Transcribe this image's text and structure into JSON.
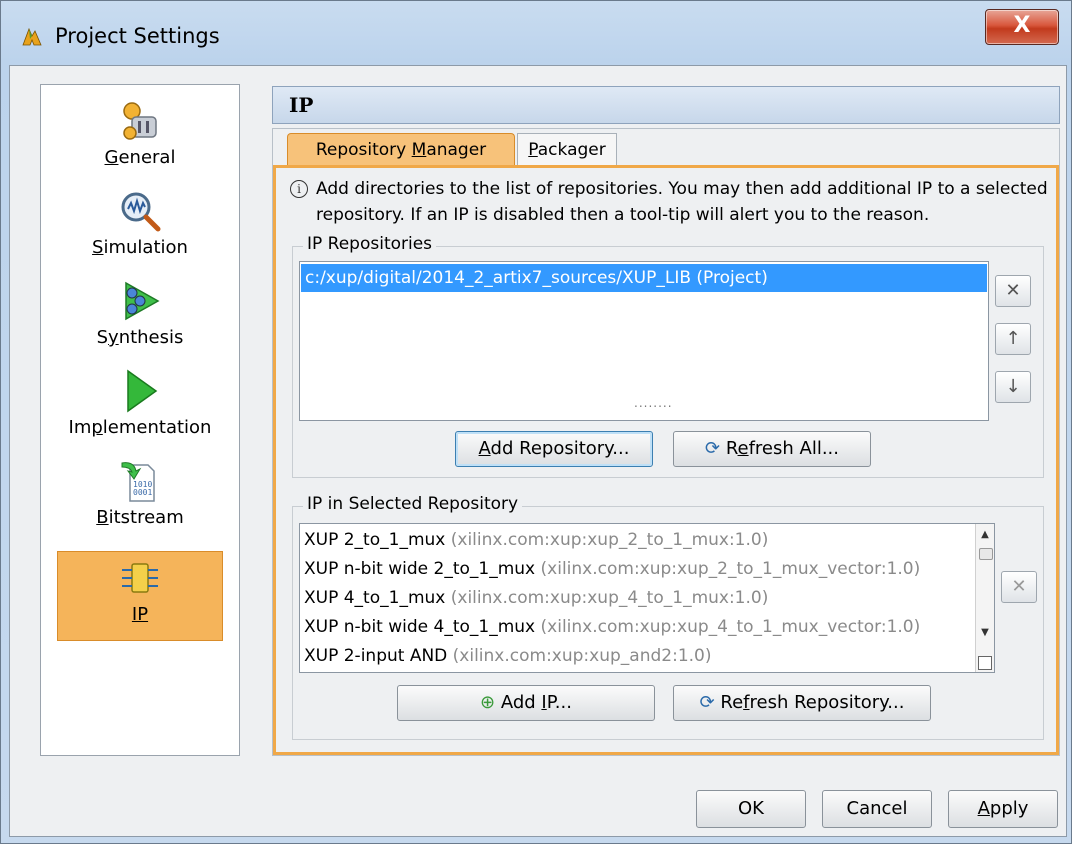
{
  "window": {
    "title": "Project Settings",
    "close_glyph": "X"
  },
  "nav": {
    "items": [
      {
        "label_u": "G",
        "label_rest": "eneral",
        "icon": "general-settings-icon"
      },
      {
        "label_u": "S",
        "label_rest": "imulation",
        "icon": "simulation-icon"
      },
      {
        "label_pre": "S",
        "label_u": "y",
        "label_rest": "nthesis",
        "icon": "synthesis-icon"
      },
      {
        "label_pre": "Im",
        "label_u": "p",
        "label_rest": "lementation",
        "icon": "implementation-icon"
      },
      {
        "label_u": "B",
        "label_rest": "itstream",
        "icon": "bitstream-icon"
      },
      {
        "label_u": "IP",
        "label_rest": "",
        "icon": "ip-icon",
        "selected": true
      }
    ]
  },
  "main": {
    "header": "IP",
    "tabs": [
      {
        "pre": "Repository ",
        "u": "M",
        "rest": "anager",
        "active": true
      },
      {
        "pre": "",
        "u": "P",
        "rest": "ackager",
        "active": false
      }
    ],
    "info_text": "Add directories to the list of repositories. You may then add additional IP to a selected repository. If an IP is disabled then a tool-tip will alert you to the reason.",
    "ip_repositories": {
      "title": "IP Repositories",
      "items": [
        "c:/xup/digital/2014_2_artix7_sources/XUP_LIB (Project)"
      ],
      "add_button": {
        "u": "A",
        "rest": "dd Repository..."
      },
      "refresh_button": {
        "pre": "R",
        "u": "e",
        "rest": "fresh All..."
      }
    },
    "splitter": "........",
    "ip_in_repo": {
      "title": "IP in Selected Repository",
      "rows": [
        {
          "name": "XUP 2_to_1_mux",
          "vlnv": "(xilinx.com:xup:xup_2_to_1_mux:1.0)"
        },
        {
          "name": "XUP n-bit wide 2_to_1_mux",
          "vlnv": "(xilinx.com:xup:xup_2_to_1_mux_vector:1.0)"
        },
        {
          "name": "XUP 4_to_1_mux",
          "vlnv": "(xilinx.com:xup:xup_4_to_1_mux:1.0)"
        },
        {
          "name": "XUP n-bit wide 4_to_1_mux",
          "vlnv": "(xilinx.com:xup:xup_4_to_1_mux_vector:1.0)"
        },
        {
          "name": "XUP 2-input AND",
          "vlnv": "(xilinx.com:xup:xup_and2:1.0)"
        }
      ],
      "add_ip_button": {
        "pre": "Add ",
        "u": "I",
        "rest": "P..."
      },
      "refresh_repo_button": {
        "pre": "Re",
        "u": "f",
        "rest": "resh Repository..."
      }
    }
  },
  "footer": {
    "ok": "OK",
    "cancel": "Cancel",
    "apply_u": "A",
    "apply_rest": "pply"
  }
}
